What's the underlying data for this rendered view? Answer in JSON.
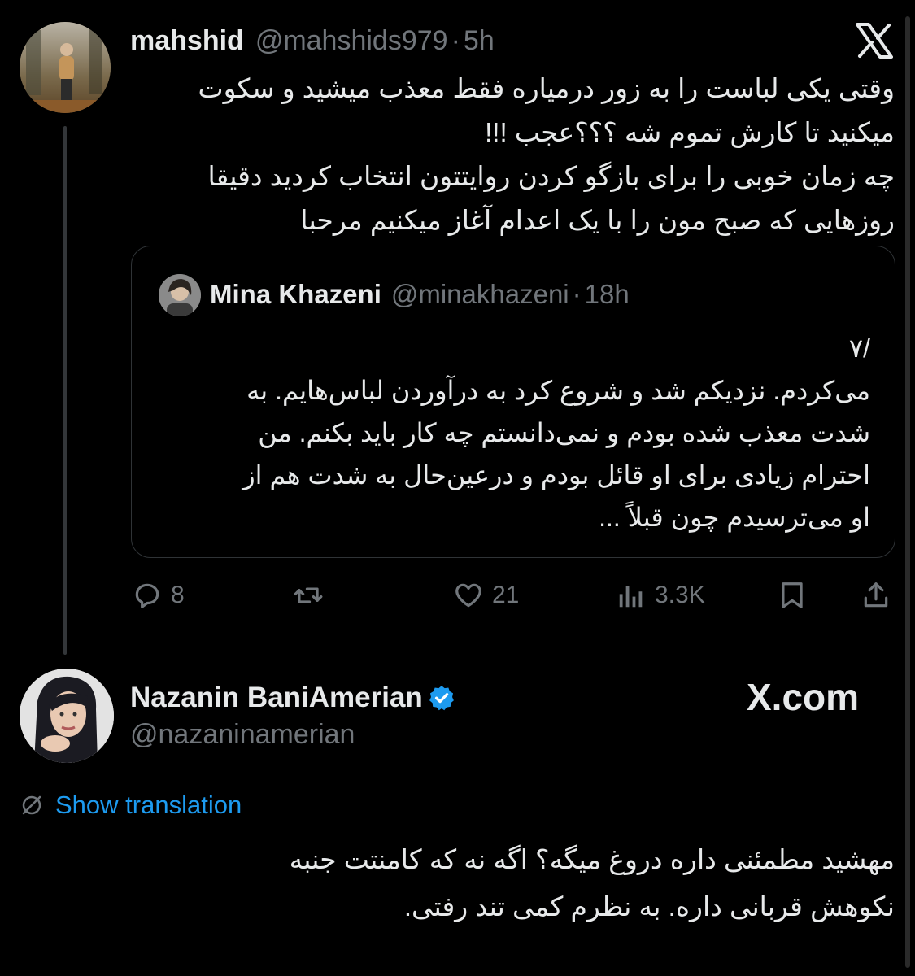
{
  "tweet": {
    "author_name": "mahshid",
    "author_handle": "@mahshids979",
    "separator": "·",
    "time": "5h",
    "text_lines": [
      "وقتی یکی لباست را به زور درمیاره فقط معذب میشید و سکوت",
      "میکنید تا کارش  تموم شه ؟؟؟عجب !!!",
      "چه زمان خوبی را برای بازگو کردن روایتتون انتخاب کردید دقیقا",
      "روزهایی که صبح مون را با یک اعدام آغاز میکنیم مرحبا"
    ]
  },
  "quoted": {
    "author_name": "Mina Khazeni",
    "author_handle": "@minakhazeni",
    "separator": "·",
    "time": "18h",
    "text_lines": [
      "/۷",
      "می‌کردم. نزدیکم شد و شروع کرد به درآوردن لباس‌هایم. به",
      "شدت معذب شده بودم و نمی‌دانستم چه کار باید بکنم. من",
      "احترام زیادی برای او قائل بودم و درعین‌حال به شدت هم از",
      "او می‌ترسیدم چون قبلاً ..."
    ]
  },
  "actions": {
    "reply_count": "8",
    "retweet_count": "",
    "like_count": "21",
    "views_count": "3.3K",
    "icons": [
      "reply-icon",
      "retweet-icon",
      "heart-icon",
      "views-icon",
      "bookmark-icon",
      "share-icon"
    ]
  },
  "reply": {
    "author_name": "Nazanin BaniAmerian",
    "author_handle": "@nazaninamerian",
    "watermark": "X.com",
    "show_translation": "Show translation",
    "text_lines": [
      "مهشید مطمئنی داره دروغ میگه؟ اگه نه که کامنتت جنبه",
      "نکوهش قربانی داره. به نظرم کمی تند رفتی."
    ]
  },
  "colors": {
    "background": "#000000",
    "text": "#e7e9ea",
    "muted": "#71767b",
    "link": "#1d9bf0",
    "verified": "#1d9bf0",
    "border": "#2f3336"
  }
}
